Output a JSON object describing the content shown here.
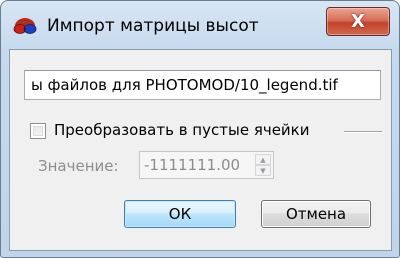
{
  "window": {
    "title": "Импорт матрицы высот",
    "app_icon": "photomod-3d-glasses-icon",
    "close_glyph": "X"
  },
  "file": {
    "path_visible": "ы файлов для PHOTOMOD/10_legend.tif"
  },
  "convert_option": {
    "label": "Преобразовать в пустые ячейки",
    "checked": false
  },
  "value_field": {
    "label": "Значение:",
    "value": "-1111111.00",
    "enabled": false
  },
  "buttons": {
    "ok": "ОК",
    "cancel": "Отмена"
  }
}
